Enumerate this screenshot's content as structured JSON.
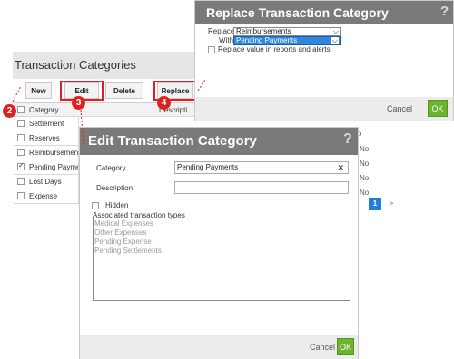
{
  "list_panel": {
    "title": "Transaction Categories",
    "toolbar": {
      "new": "New",
      "edit": "Edit",
      "delete": "Delete",
      "replace": "Replace"
    },
    "columns": {
      "category": "Category",
      "description": "Descripti"
    },
    "rows": [
      {
        "category": "Settlement",
        "checked": false
      },
      {
        "category": "Reserves",
        "checked": false
      },
      {
        "category": "Reimbursement",
        "checked": false
      },
      {
        "category": "Pending Payme",
        "checked": true
      },
      {
        "category": "Lost Days",
        "checked": false
      },
      {
        "category": "Expense",
        "checked": false
      }
    ],
    "side_values": [
      "No",
      "No",
      "No",
      "No",
      "No",
      "No"
    ],
    "pagination": {
      "current": "1",
      "next": ">"
    }
  },
  "markers": {
    "new": "2",
    "edit": "3",
    "replace": "4"
  },
  "replace_dialog": {
    "title": "Replace Transaction Category",
    "help": "?",
    "replace_label": "Replace",
    "replace_value": "Reimbursements",
    "with_label": "With",
    "with_value": "Pending Payments",
    "checkbox_label": "Replace value in reports and alerts",
    "cancel": "Cancel",
    "ok": "OK"
  },
  "edit_dialog": {
    "title": "Edit Transaction Category",
    "help": "?",
    "category_label": "Category",
    "category_value": "Pending Payments",
    "clear_glyph": "✕",
    "description_label": "Description",
    "description_value": "",
    "hidden_label": "Hidden",
    "assoc_label": "Associated transaction types",
    "assoc_items": [
      "Medical Expenses",
      "Other Expenses",
      "Pending Expense",
      "Pending Settlements"
    ],
    "cancel": "Cancel",
    "ok": "OK"
  },
  "colors": {
    "title_bar": "#7a7a7a",
    "ok_green": "#6ab42e",
    "marker_red": "#e02020",
    "select_blue": "#2e86de",
    "page_blue": "#1e7fd4"
  }
}
